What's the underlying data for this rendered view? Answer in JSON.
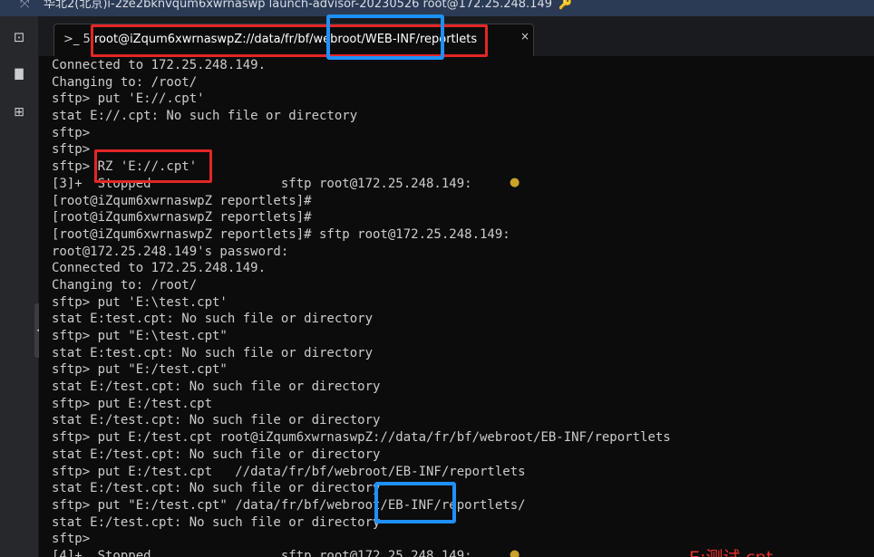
{
  "window": {
    "title": "华北2(北京)i-2ze2bknvqum6xwrnaswp   launch-advisor-20230526   root@172.25.248.149",
    "expand_icon": "expand-icon",
    "key_icon": "key-icon"
  },
  "sidebar": {
    "items": [
      {
        "icon": "terminal-icon",
        "glyph": "⊡"
      },
      {
        "icon": "file-icon",
        "glyph": "▇"
      },
      {
        "icon": "grid-icon",
        "glyph": "⊞"
      }
    ]
  },
  "tab": {
    "prefix": ">_ 5.",
    "label": "root@iZqum6xwrnaswpZ://data/fr/bf/webroot/WEB-INF/reportlets",
    "close": "×"
  },
  "terminal": {
    "lines": [
      "Connected to 172.25.248.149.",
      "Changing to: /root/",
      "sftp> put 'E://.cpt'",
      "stat E://.cpt: No such file or directory",
      "sftp>",
      "sftp>",
      "sftp> RZ 'E://.cpt'",
      "[3]+  Stopped                 sftp root@172.25.248.149:",
      "[root@iZqum6xwrnaswpZ reportlets]#",
      "[root@iZqum6xwrnaswpZ reportlets]#",
      "[root@iZqum6xwrnaswpZ reportlets]# sftp root@172.25.248.149:",
      "root@172.25.248.149's password:",
      "Connected to 172.25.248.149.",
      "Changing to: /root/",
      "sftp> put 'E:\\test.cpt'",
      "stat E:test.cpt: No such file or directory",
      "sftp> put \"E:\\test.cpt\"",
      "stat E:test.cpt: No such file or directory",
      "sftp> put \"E:/test.cpt\"",
      "stat E:/test.cpt: No such file or directory",
      "sftp> put E:/test.cpt",
      "stat E:/test.cpt: No such file or directory",
      "sftp> put E:/test.cpt root@iZqum6xwrnaswpZ://data/fr/bf/webroot/EB-INF/reportlets",
      "stat E:/test.cpt: No such file or directory",
      "sftp> put E:/test.cpt   //data/fr/bf/webroot/EB-INF/reportlets",
      "stat E:/test.cpt: No such file or directory",
      "sftp> put \"E:/test.cpt\" /data/fr/bf/webroot/EB-INF/reportlets/",
      "stat E:/test.cpt: No such file or directory",
      "sftp>",
      "[4]+  Stopped                 sftp root@172.25.248.149:"
    ]
  },
  "annotation": {
    "note": "E:测试.cpt"
  },
  "tip_icon": "lightbulb-icon"
}
